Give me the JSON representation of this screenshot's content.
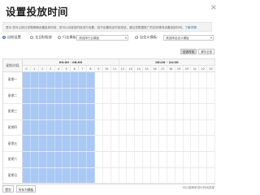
{
  "dialog": {
    "title": "设置投放时间",
    "close_glyph": "×"
  },
  "notice": {
    "text": "提示:您可以按日或周精确设置投放时段，您可以对投放时段进行设置，若不设置则全时段投放，建议您根据推广的实际情况设置投放时间，",
    "link": "了解详情"
  },
  "modes": {
    "options": [
      {
        "label": "自助设置",
        "selected": true
      },
      {
        "label": "全日制投放",
        "selected": false
      },
      {
        "label": "行业模板:",
        "selected": false
      },
      {
        "label": "自定义模板:",
        "selected": false
      }
    ],
    "industry_select": "请选择行业模板",
    "custom_select": "请选择自定义模板"
  },
  "actions": {
    "select_all": "全选时段",
    "clear_all": "清除全部"
  },
  "grid": {
    "corner_label": "星期\\时段",
    "am_label": "00:00 - 06:00",
    "pm_label": "06:00 - 24:00",
    "hours": [
      "0",
      "1",
      "2",
      "3",
      "4",
      "5",
      "6",
      "7",
      "8",
      "9",
      "10",
      "11",
      "12",
      "13",
      "14",
      "15",
      "16",
      "17",
      "18",
      "19",
      "20",
      "21",
      "22",
      "23"
    ],
    "days": [
      "星期一",
      "星期二",
      "星期三",
      "星期四",
      "星期五",
      "星期六",
      "星期日"
    ],
    "selected_hours_per_day": [
      0,
      1,
      2,
      3,
      4,
      5,
      6,
      7,
      8
    ],
    "selected_color": "#a9c8f4"
  },
  "footer": {
    "ok_label": "提交",
    "save_label": "另存为模板",
    "note": "可以拖拽来进行时间选择"
  }
}
